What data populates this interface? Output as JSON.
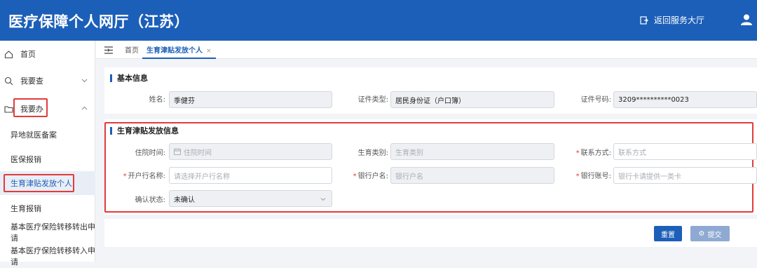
{
  "header": {
    "title": "医疗保障个人网厅（江苏）",
    "return_label": "返回服务大厅"
  },
  "sidebar": {
    "items": [
      {
        "label": "首页",
        "icon": "home-icon"
      },
      {
        "label": "我要查",
        "icon": "search-icon"
      },
      {
        "label": "我要办",
        "icon": "folder-icon"
      }
    ],
    "sub_items": [
      {
        "label": "异地就医备案"
      },
      {
        "label": "医保报销"
      },
      {
        "label": "生育津贴发放个人",
        "active": true
      },
      {
        "label": "生育报销"
      },
      {
        "label": "基本医疗保险转移转出申请"
      },
      {
        "label": "基本医疗保险转移转入申请"
      }
    ]
  },
  "tabs": {
    "home": "首页",
    "current": "生育津贴发放个人",
    "close": "×"
  },
  "basic": {
    "title": "基本信息",
    "name_label": "姓名:",
    "name_value": "季健芬",
    "idtype_label": "证件类型:",
    "idtype_value": "居民身份证（户口簿）",
    "idno_label": "证件号码:",
    "idno_value": "3209**********0023"
  },
  "allowance": {
    "title": "生育津贴发放信息",
    "hosp_label": "住院时间:",
    "hosp_placeholder": "住院时间",
    "type_label": "生育类别:",
    "type_placeholder": "生育类别",
    "contact_label": "联系方式:",
    "contact_placeholder": "联系方式",
    "bank_label": "开户行名称:",
    "bank_placeholder": "请选择开户行名称",
    "acctname_label": "银行户名:",
    "acctname_placeholder": "银行户名",
    "acctno_label": "银行账号:",
    "acctno_placeholder": "银行卡请提供一类卡",
    "status_label": "确认状态:",
    "status_value": "未确认",
    "required_mark": "*"
  },
  "actions": {
    "reset": "重置",
    "submit": "提交"
  },
  "colors": {
    "primary": "#1c5fb8",
    "highlight": "#e23b3b"
  }
}
